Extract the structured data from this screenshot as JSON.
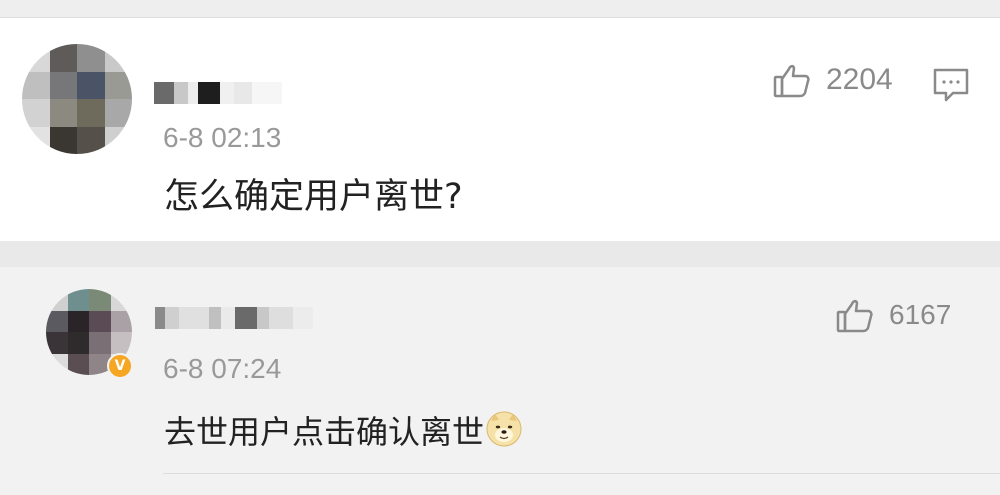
{
  "comments": [
    {
      "timestamp": "6-8 02:13",
      "text": "怎么确定用户离世?",
      "like_count": "2204",
      "avatar_icon": "pixelated-avatar",
      "like_icon": "thumbs-up-icon",
      "reply_icon": "comment-icon"
    },
    {
      "timestamp": "6-8 07:24",
      "text": "去世用户点击确认离世",
      "like_count": "6167",
      "avatar_icon": "pixelated-avatar",
      "verified_badge": "V",
      "emoji_icon": "doge-emoji",
      "like_icon": "thumbs-up-icon"
    }
  ],
  "colors": {
    "card_bg": "#ffffff",
    "page_bg": "#f2f2f2",
    "meta_text": "#999999",
    "body_text": "#222222",
    "verified": "#f5a623"
  }
}
